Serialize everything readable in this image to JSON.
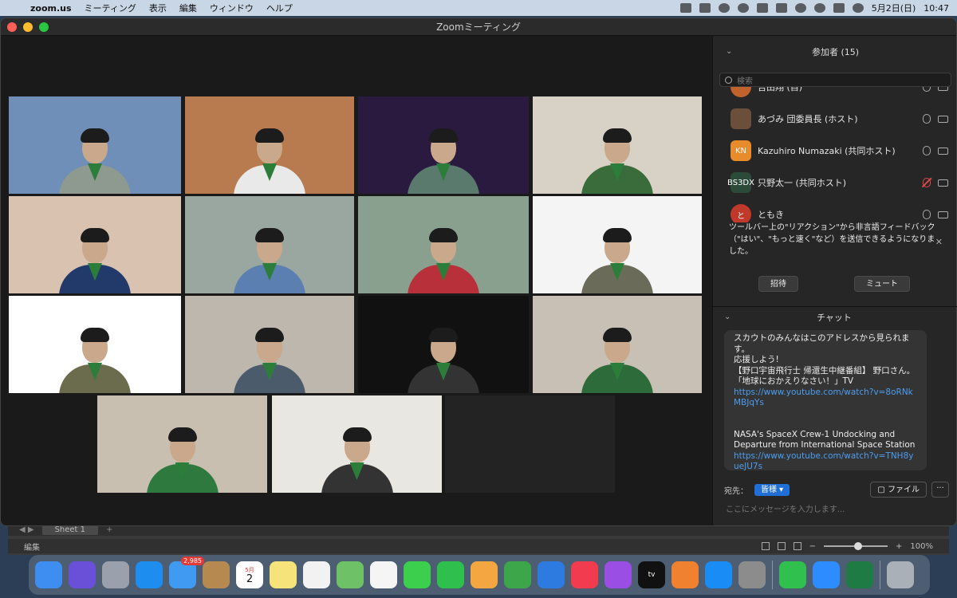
{
  "menubar": {
    "app_name": "zoom.us",
    "menus": [
      "ミーティング",
      "表示",
      "編集",
      "ウィンドウ",
      "ヘルプ"
    ],
    "date": "5月2日(日)",
    "time": "10:47"
  },
  "window": {
    "title": "Zoomミーティング"
  },
  "participants_panel": {
    "title": "参加者 (15)",
    "search_placeholder": "検索",
    "items": [
      {
        "name": "吉田翔 (自)",
        "avatar_text": "",
        "avatar_color": "#c0622e",
        "muted": false
      },
      {
        "name": "あづみ 団委員長 (ホスト)",
        "avatar_text": "",
        "avatar_color": "#6b4f3a",
        "muted": false
      },
      {
        "name": "Kazuhiro Numazaki (共同ホスト)",
        "avatar_text": "KN",
        "avatar_color": "#e88b2a",
        "muted": false
      },
      {
        "name": "只野太一 (共同ホスト)",
        "avatar_text": "BS3DX",
        "avatar_color": "#2b4a3a",
        "muted": true
      },
      {
        "name": "ともき",
        "avatar_text": "と",
        "avatar_color": "#c0392b",
        "muted": false
      }
    ],
    "tooltip": "ツールバー上の\"リアクション\"から非言語フィードバック（\"はい\"、\"もっと速く\"など）を送信できるようになりました。",
    "invite_label": "招待",
    "mute_label": "ミュート"
  },
  "chat_panel": {
    "title": "チャット",
    "message_lines": [
      "スカウトのみんなはこのアドレスから見られます。",
      "応援しよう!",
      "【野口宇宙飛行士 帰還生中継番組】 野口さん。",
      "「地球におかえりなさい！」TV"
    ],
    "link1": "https://www.youtube.com/watch?v=8oRNkMBJqYs",
    "message2": "NASA's SpaceX Crew-1 Undocking and Departure from International Space Station",
    "link2": "https://www.youtube.com/watch?v=TNH8yueJU7s",
    "to_label": "宛先：",
    "to_value": "皆様",
    "file_label": "ファイル",
    "more_label": "···",
    "input_placeholder": "ここにメッセージを入力します..."
  },
  "background_window": {
    "sheet_tab": "Sheet 1",
    "status_left": "編集",
    "zoom_level": "100%",
    "zoom_minus": "−",
    "zoom_plus": "+"
  },
  "gallery": {
    "tiles": [
      {
        "label": "scout-leader-tokyo-tower",
        "bg": "#6f8fb8",
        "body": "#8e9a8f"
      },
      {
        "label": "young-man-sunset-city",
        "bg": "#b87a4f",
        "body": "#e9e9e9"
      },
      {
        "label": "man-colorful-background",
        "bg": "#2b1a3f",
        "body": "#5a7a6e"
      },
      {
        "label": "boy-room",
        "bg": "#d8d2c6",
        "body": "#3a6b3a"
      },
      {
        "label": "boy-1",
        "bg": "#d9c3b0",
        "body": "#223a6a"
      },
      {
        "label": "boy-2",
        "bg": "#9aa7a0",
        "body": "#5a7fb0"
      },
      {
        "label": "boy-3-red",
        "bg": "#8aa08f",
        "body": "#b8313a"
      },
      {
        "label": "scout-house-slide",
        "bg": "#f4f4f4",
        "body": "#6b6b5a"
      },
      {
        "label": "leader-blue-logo",
        "bg": "#ffffff",
        "body": "#6b6b4e"
      },
      {
        "label": "boy-4",
        "bg": "#bdb7ad",
        "body": "#4b5b6b"
      },
      {
        "label": "screen-share-peace",
        "bg": "#111111",
        "body": "#333333"
      },
      {
        "label": "boy-with-cat",
        "bg": "#c8c0b4",
        "body": "#2e6b3b"
      },
      {
        "label": "man-glasses-green",
        "bg": "#c9bfb0",
        "body": "#2e7a3e"
      },
      {
        "label": "boy-5",
        "bg": "#e9e7e2",
        "body": "#333333"
      }
    ]
  },
  "dock": {
    "mail_badge": "2,985",
    "calendar_month": "5月",
    "calendar_day": "2",
    "tv_label": "tv"
  }
}
